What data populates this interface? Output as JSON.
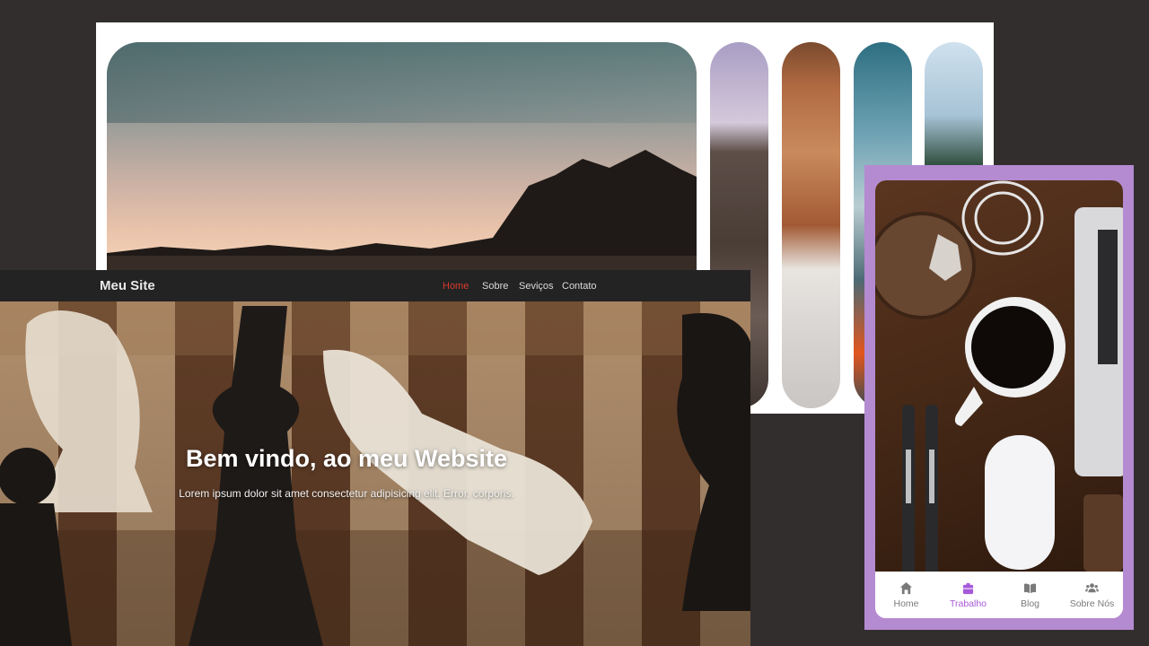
{
  "website": {
    "logo": "Meu Site",
    "nav": {
      "home": "Home",
      "sobre": "Sobre",
      "servicos": "Seviços",
      "contato": "Contato"
    },
    "hero": {
      "title": "Bem vindo, ao meu Website",
      "subtitle": "Lorem ipsum dolor sit amet consectetur adipisicing elit. Error, corporis."
    },
    "colors": {
      "navbar": "#232323",
      "active_link": "#d83a2f"
    }
  },
  "mobile_app": {
    "tabs": [
      {
        "label": "Home",
        "icon": "home-icon",
        "active": false
      },
      {
        "label": "Trabalho",
        "icon": "briefcase-icon",
        "active": true
      },
      {
        "label": "Blog",
        "icon": "book-icon",
        "active": false
      },
      {
        "label": "Sobre Nós",
        "icon": "users-icon",
        "active": false
      }
    ],
    "colors": {
      "frame": "#b48ad0",
      "active_tab": "#a659d9"
    }
  }
}
